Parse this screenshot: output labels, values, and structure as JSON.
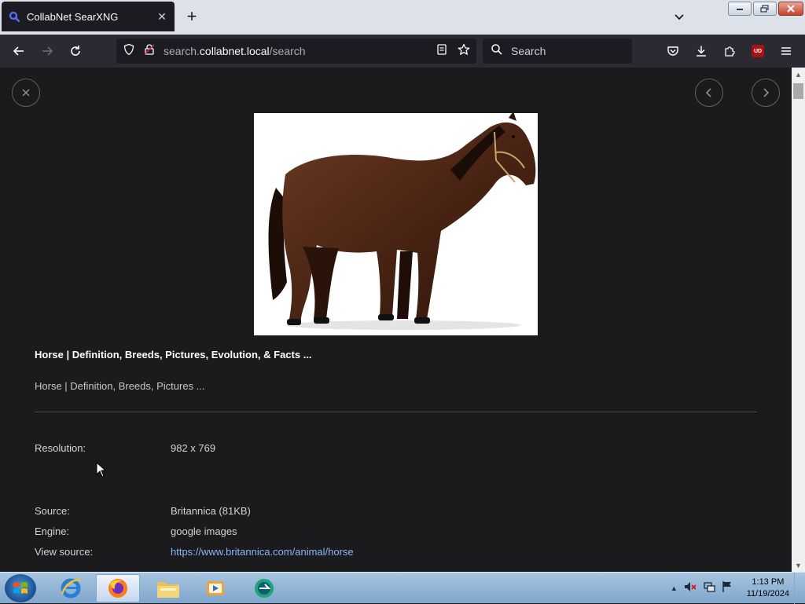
{
  "browser": {
    "tab": {
      "title": "CollabNet SearXNG"
    },
    "address": {
      "prefix": "search.",
      "host": "collabnet.local",
      "path": "/search"
    },
    "search": {
      "placeholder": "Search"
    },
    "ublock_badge": "UD"
  },
  "page": {
    "result": {
      "title": "Horse | Definition, Breeds, Pictures, Evolution, & Facts ...",
      "description": "Horse | Definition, Breeds, Pictures ..."
    },
    "details": {
      "resolution_label": "Resolution:",
      "resolution_value": "982 x 769",
      "source_label": "Source:",
      "source_value": "Britannica (81KB)",
      "engine_label": "Engine:",
      "engine_value": "google images",
      "view_source_label": "View source:",
      "view_source_value": "https://www.britannica.com/animal/horse"
    }
  },
  "taskbar": {
    "apps": [
      "internet-explorer-icon",
      "firefox-icon",
      "file-explorer-icon",
      "media-player-icon",
      "app-icon"
    ],
    "clock": {
      "time": "1:13 PM",
      "date": "11/19/2024"
    }
  },
  "colors": {
    "link": "#8ab4f8",
    "page_bg": "#1b1b1d",
    "tab_bg": "#1c1b22",
    "toolbar_bg": "#2b2a33"
  }
}
